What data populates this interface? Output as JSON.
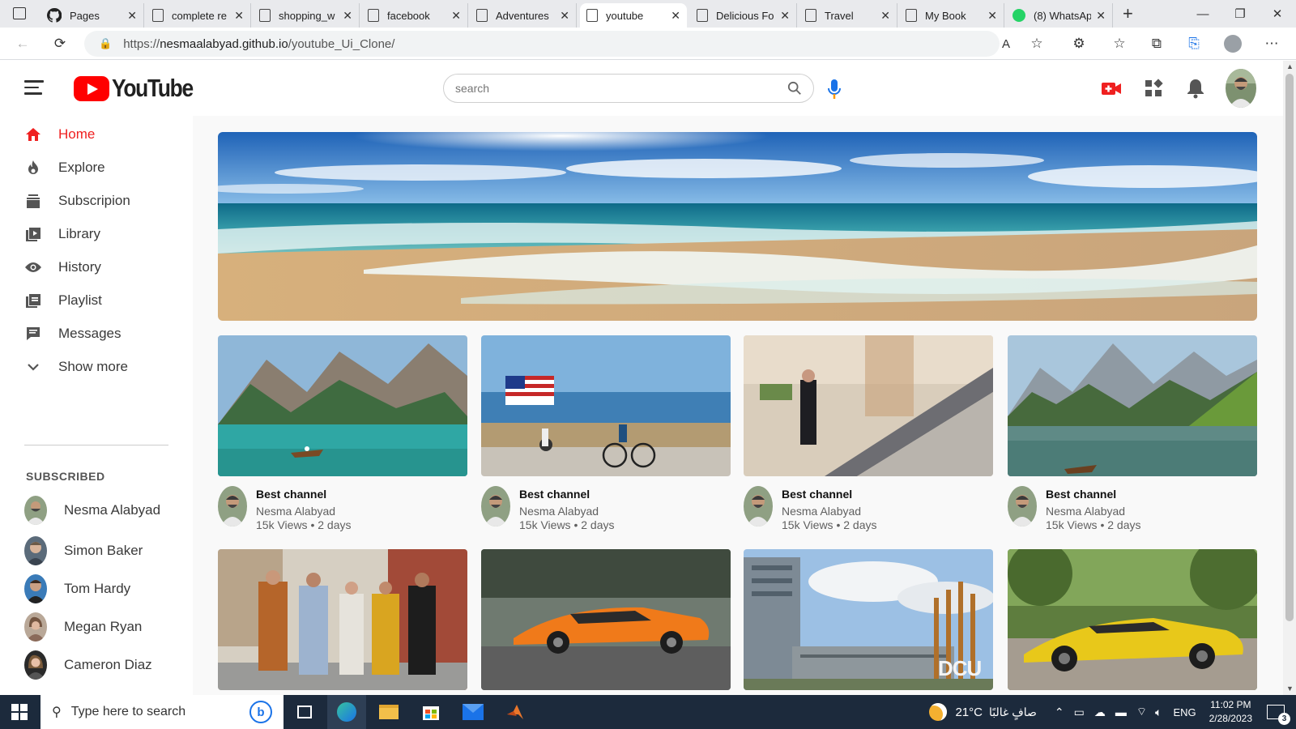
{
  "browser": {
    "tabs": [
      {
        "title": "Pages",
        "icon": "github-icon"
      },
      {
        "title": "complete re",
        "icon": "page-icon"
      },
      {
        "title": "shopping_w",
        "icon": "page-icon"
      },
      {
        "title": "facebook",
        "icon": "page-icon"
      },
      {
        "title": "Adventures",
        "icon": "page-icon"
      },
      {
        "title": "youtube",
        "icon": "page-icon",
        "active": true
      },
      {
        "title": "Delicious Fo",
        "icon": "page-icon"
      },
      {
        "title": "Travel",
        "icon": "page-icon"
      },
      {
        "title": "My Book",
        "icon": "page-icon"
      },
      {
        "title": "(8) WhatsAp",
        "icon": "whatsapp-icon"
      }
    ],
    "url_prefix": "https://",
    "url_host": "nesmaalabyad.github.io",
    "url_path": "/youtube_Ui_Clone/"
  },
  "header": {
    "logo_text": "YouTube",
    "search_placeholder": "search"
  },
  "sidebar": {
    "items": [
      {
        "label": "Home",
        "icon": "home-icon",
        "active": true
      },
      {
        "label": "Explore",
        "icon": "fire-icon"
      },
      {
        "label": "Subscripion",
        "icon": "subscriptions-icon"
      },
      {
        "label": "Library",
        "icon": "library-icon"
      },
      {
        "label": "History",
        "icon": "eye-icon"
      },
      {
        "label": "Playlist",
        "icon": "playlist-icon"
      },
      {
        "label": "Messages",
        "icon": "message-icon"
      },
      {
        "label": "Show more",
        "icon": "chevron-down-icon"
      }
    ],
    "subscribed_heading": "SUBSCRIBED",
    "subscriptions": [
      {
        "name": "Nesma Alabyad"
      },
      {
        "name": "Simon Baker"
      },
      {
        "name": "Tom Hardy"
      },
      {
        "name": "Megan Ryan"
      },
      {
        "name": "Cameron Diaz"
      }
    ]
  },
  "videos": [
    {
      "title": "Best channel",
      "channel": "Nesma Alabyad",
      "stats": "15k Views • 2 days",
      "thumb": "lake-boat"
    },
    {
      "title": "Best channel",
      "channel": "Nesma Alabyad",
      "stats": "15k Views • 2 days",
      "thumb": "beach-flag-bike"
    },
    {
      "title": "Best channel",
      "channel": "Nesma Alabyad",
      "stats": "15k Views • 2 days",
      "thumb": "mall-escalator"
    },
    {
      "title": "Best channel",
      "channel": "Nesma Alabyad",
      "stats": "15k Views • 2 days",
      "thumb": "mountain-lake"
    },
    {
      "thumb": "friends-street"
    },
    {
      "thumb": "orange-car"
    },
    {
      "thumb": "dcu-building",
      "overlay": "DCU"
    },
    {
      "thumb": "yellow-car"
    }
  ],
  "taskbar": {
    "search_placeholder": "Type here to search",
    "weather": "21°C",
    "weather_desc": "صافٍ غالبًا",
    "lang": "ENG",
    "time": "11:02 PM",
    "date": "2/28/2023",
    "notifications": "3"
  },
  "colors": {
    "accent": "#ff0000",
    "active_nav": "#ef2020",
    "taskbar": "#1c2a3c"
  }
}
